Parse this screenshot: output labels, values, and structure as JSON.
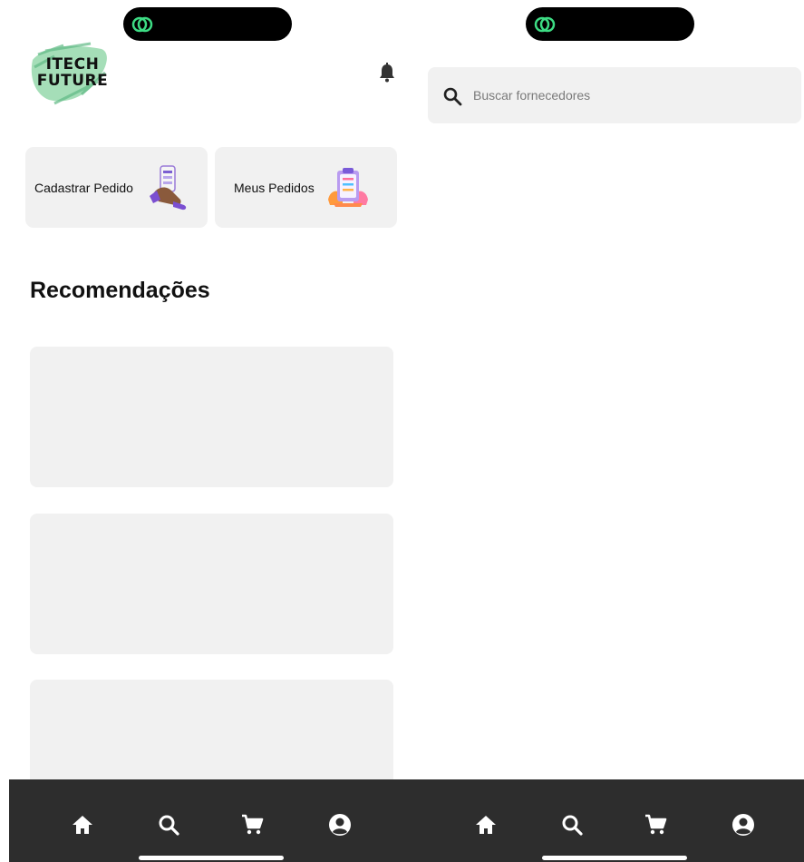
{
  "home": {
    "logo_text": "ITECH FUTURE",
    "actions": [
      {
        "label": "Cadastrar Pedido"
      },
      {
        "label": "Meus Pedidos"
      }
    ],
    "section_title": "Recomendações",
    "recommendations": [
      {},
      {},
      {}
    ]
  },
  "search": {
    "placeholder": "Buscar fornecedores"
  },
  "tabbar": {
    "items": [
      "home-icon",
      "search-icon",
      "cart-icon",
      "account-icon"
    ],
    "background": "#2d2d2d"
  },
  "colors": {
    "accent_green": "#3ddc84",
    "card_bg": "#f1f1f1"
  }
}
